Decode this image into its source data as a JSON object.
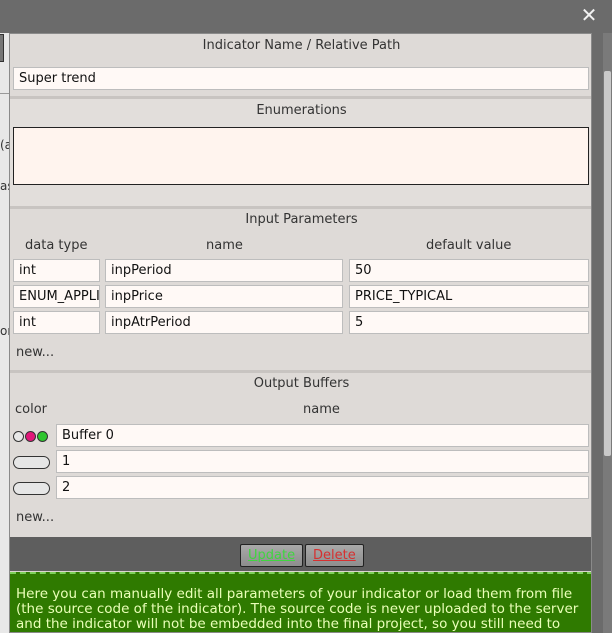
{
  "dialog": {
    "close_symbol": "✕",
    "name_section": {
      "title": "Indicator Name / Relative Path",
      "value": "Super trend"
    },
    "enum_section": {
      "title": "Enumerations",
      "value": ""
    },
    "inputs_section": {
      "title": "Input Parameters",
      "headers": {
        "type": "data type",
        "name": "name",
        "default": "default value"
      },
      "rows": [
        {
          "type": "int",
          "name": "inpPeriod",
          "default": "50"
        },
        {
          "type": "ENUM_APPLIED_PRICE",
          "name": "inpPrice",
          "default": "PRICE_TYPICAL"
        },
        {
          "type": "int",
          "name": "inpAtrPeriod",
          "default": "5"
        }
      ],
      "new_label": "new..."
    },
    "buffers_section": {
      "title": "Output Buffers",
      "headers": {
        "color": "color",
        "name": "name"
      },
      "rows": [
        {
          "name": "Buffer 0",
          "colors": [
            "#e8e8e8",
            "#e0187a",
            "#2ec52e"
          ]
        },
        {
          "name": "1",
          "colors": []
        },
        {
          "name": "2",
          "colors": []
        }
      ],
      "new_label": "new..."
    },
    "buttons": {
      "update": "Update",
      "delete": "Delete"
    },
    "help_text": "Here you can manually edit all parameters of your indicator or load them from file (the source code of the indicator). The source code is never uploaded to the server and the indicator will not be embedded into the final project, so you still need to have it in your \"Indicators\" folder."
  },
  "background": {
    "fragments": [
      "(a",
      "as",
      "or"
    ]
  }
}
